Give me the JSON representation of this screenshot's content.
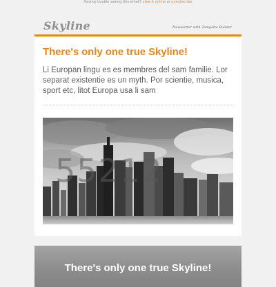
{
  "preheader": {
    "text": "Having trouble seeing this email?",
    "view_online": "view it online",
    "or": "or",
    "unsubscribe": "unsubscribe"
  },
  "header": {
    "logo": "Skyline",
    "tagline": "Newsletter with Template Builder"
  },
  "main": {
    "headline": "There's only one true Skyline!",
    "intro": "Li Europan lingu es es membres del sam familie. Lor separat existentie es un myth. Por scientie, musica, sport etc, litot Europa usa li sam",
    "image_overlay": "55212"
  },
  "secondary": {
    "headline": "There's only one true Skyline!"
  },
  "colors": {
    "accent": "#e8861a",
    "background": "#f1f1f1",
    "card": "#ffffff",
    "secondary_card": "#8c8c8c"
  }
}
